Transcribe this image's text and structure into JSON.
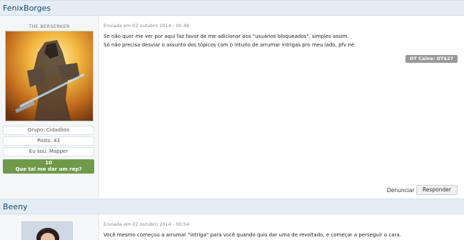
{
  "post1": {
    "author": "FenixBorges",
    "user_title": "THE BERSERKER",
    "group": "Grupo: Cidadãos",
    "posts": "Posts: 43",
    "role": "Eu sou: Mapper",
    "rep_count": "10",
    "rep_label": "Que tal me dar um rep?",
    "posted": "Enviada em 02 outubro 2014 - 00:48",
    "line1": "Se não quer me ver por aqui faz favor de me adicionar aos \"usuários bloqueados\", simples assim.",
    "line2": "Só não precisa desviar o assunto dos tópicos com o intuito de arrumar intrigas pro meu lado, pfv né.",
    "signature": "OT Caine: OT$27",
    "report": "Denunciar",
    "reply": "Responder"
  },
  "post2": {
    "author": "Beeny",
    "posted": "Enviada em 02 outubro 2014 - 00:54",
    "line1": "Você mesmo começou a arrumar \"intriga\" para você quando quis dar uma de revoltado, e começar a perseguir o cara."
  }
}
